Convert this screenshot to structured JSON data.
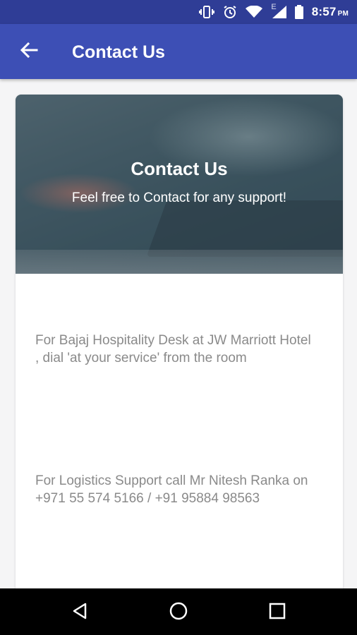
{
  "status_bar": {
    "time": "8:57",
    "ampm": "PM",
    "network_letter": "E",
    "icons": [
      "vibrate-icon",
      "alarm-icon",
      "wifi-icon",
      "signal-icon",
      "battery-icon"
    ]
  },
  "app_bar": {
    "title": "Contact Us",
    "back_icon": "arrow-left-icon"
  },
  "hero": {
    "title": "Contact Us",
    "subtitle": "Feel free to Contact for any support!"
  },
  "contacts": [
    {
      "text": "For Bajaj Hospitality Desk at JW Marriott Hotel , dial 'at your service' from the room"
    },
    {
      "text": "For Logistics Support call Mr Nitesh Ranka on +971 55 574 5166 / +91 95884 98563"
    }
  ],
  "nav_bar": {
    "icons": [
      "back-triangle-icon",
      "home-circle-icon",
      "recents-square-icon"
    ]
  },
  "colors": {
    "status_bar": "#2f3d96",
    "app_bar": "#3d4fb5",
    "body_text": "#8a8a8a"
  }
}
